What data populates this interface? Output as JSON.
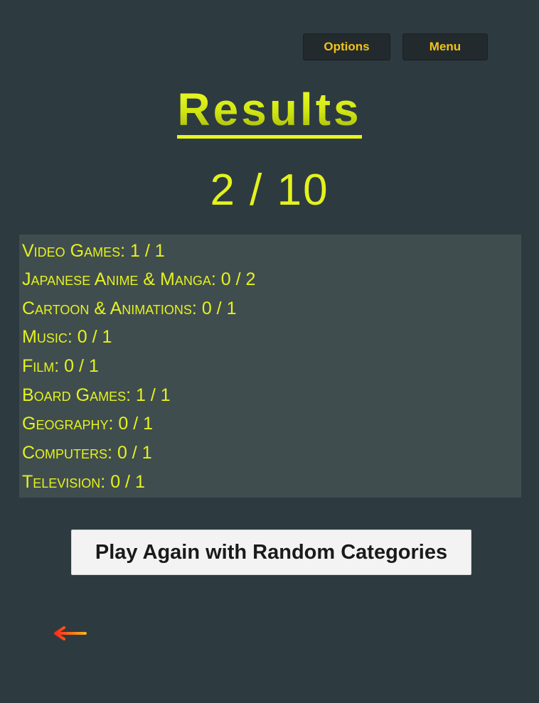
{
  "header": {
    "options_label": "Options",
    "menu_label": "Menu"
  },
  "results": {
    "title": "Results",
    "score": "2 / 10"
  },
  "categories": [
    {
      "label": "Video Games: 1 / 1"
    },
    {
      "label": "Japanese Anime & Manga: 0 / 2"
    },
    {
      "label": "Cartoon & Animations: 0 / 1"
    },
    {
      "label": "Music: 0 / 1"
    },
    {
      "label": "Film: 0 / 1"
    },
    {
      "label": "Board Games: 1 / 1"
    },
    {
      "label": "Geography: 0 / 1"
    },
    {
      "label": "Computers: 0 / 1"
    },
    {
      "label": "Television: 0 / 1"
    }
  ],
  "actions": {
    "play_again_label": "Play Again with Random Categories",
    "back_icon": "arrow-left-icon"
  },
  "colors": {
    "background": "#2d3b40",
    "accent_yellow": "#e4f21d",
    "button_gold": "#f2c21b",
    "panel": "#404d4f",
    "arrow_start": "#ff2a1a",
    "arrow_end": "#ffb21a"
  }
}
